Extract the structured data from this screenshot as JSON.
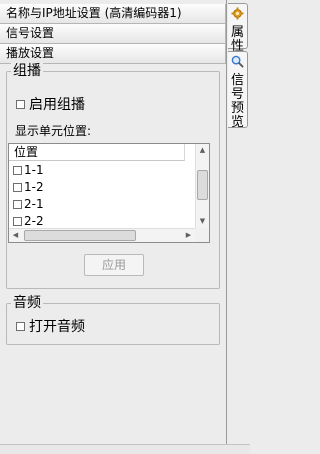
{
  "headers": {
    "name_ip": "名称与IP地址设置 (高清编码器1)",
    "signal": "信号设置",
    "playback": "播放设置"
  },
  "multicast": {
    "group_title": "组播",
    "enable_label": "启用组播",
    "enable_checked": false,
    "display_label": "显示单元位置:",
    "column_header": "位置",
    "items": [
      "1-1",
      "1-2",
      "2-1",
      "2-2"
    ],
    "apply_label": "应用"
  },
  "audio": {
    "group_title": "音频",
    "open_label": "打开音频",
    "open_checked": false
  },
  "sidebar": {
    "tab_properties": [
      "属",
      "性"
    ],
    "tab_preview": [
      "信",
      "号",
      "预",
      "览"
    ]
  }
}
